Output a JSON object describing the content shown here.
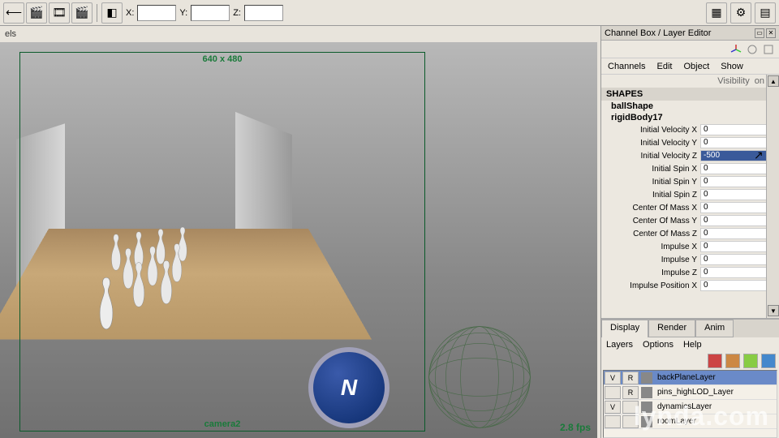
{
  "toolbar": {
    "coords": {
      "x_label": "X:",
      "y_label": "Y:",
      "z_label": "Z:",
      "x": "",
      "y": "",
      "z": ""
    }
  },
  "viewport": {
    "panel_label": "els",
    "resolution_gate": "640 x 480",
    "camera": "camera2",
    "fps": "2.8 fps"
  },
  "channel_box": {
    "title": "Channel Box / Layer Editor",
    "menu": [
      "Channels",
      "Edit",
      "Object",
      "Show"
    ],
    "visibility_label": "Visibility",
    "visibility_value": "on",
    "shapes_header": "SHAPES",
    "shapes": [
      "ballShape",
      "rigidBody17"
    ],
    "attrs": [
      {
        "label": "Initial Velocity X",
        "value": "0"
      },
      {
        "label": "Initial Velocity Y",
        "value": "0"
      },
      {
        "label": "Initial Velocity Z",
        "value": "-500",
        "selected": true
      },
      {
        "label": "Initial Spin X",
        "value": "0"
      },
      {
        "label": "Initial Spin Y",
        "value": "0"
      },
      {
        "label": "Initial Spin Z",
        "value": "0"
      },
      {
        "label": "Center Of Mass X",
        "value": "0"
      },
      {
        "label": "Center Of Mass Y",
        "value": "0"
      },
      {
        "label": "Center Of Mass Z",
        "value": "0"
      },
      {
        "label": "Impulse X",
        "value": "0"
      },
      {
        "label": "Impulse Y",
        "value": "0"
      },
      {
        "label": "Impulse Z",
        "value": "0"
      },
      {
        "label": "Impulse Position X",
        "value": "0"
      }
    ]
  },
  "layer_editor": {
    "tabs": [
      "Display",
      "Render",
      "Anim"
    ],
    "menu": [
      "Layers",
      "Options",
      "Help"
    ],
    "layers": [
      {
        "v": "V",
        "r": "R",
        "name": "backPlaneLayer",
        "selected": true
      },
      {
        "v": "",
        "r": "R",
        "name": "pins_highLOD_Layer"
      },
      {
        "v": "V",
        "r": "",
        "name": "dynamicsLayer"
      },
      {
        "v": "",
        "r": "",
        "name": "roomLayer"
      }
    ]
  },
  "watermark": "lynda.com"
}
